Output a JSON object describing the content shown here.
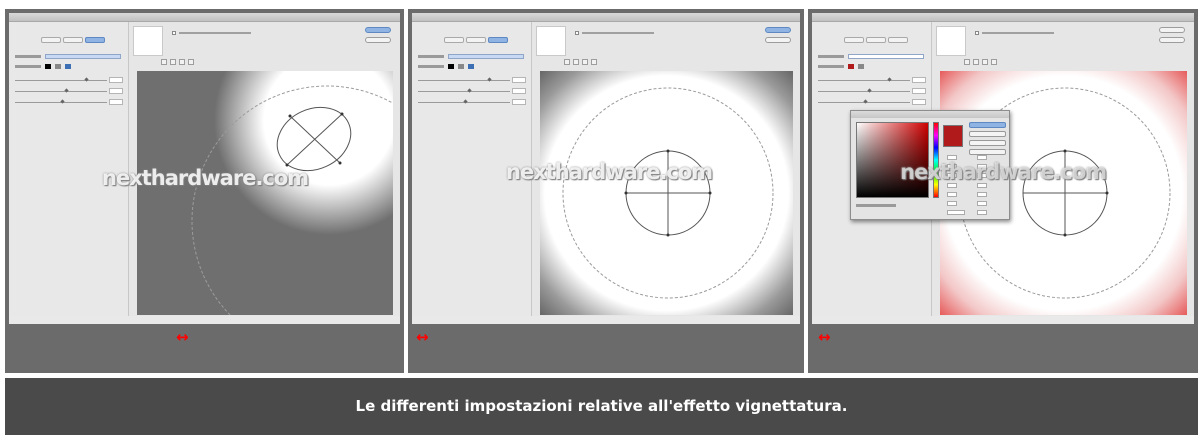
{
  "screenshots": [
    {
      "watermark": "nexthardware.com",
      "arrow": "↔"
    },
    {
      "watermark": "nexthardware.com",
      "arrow": "↔"
    },
    {
      "watermark": "nexthardware.com",
      "arrow": "↔"
    }
  ],
  "caption": "Le differenti impostazioni relative all'effetto vignettatura.",
  "colors": {
    "panel_bg": "#6b6b6b",
    "caption_bg": "#4a4a4a",
    "arrow": "#ff0000",
    "picked_color": "#b01a1a"
  }
}
